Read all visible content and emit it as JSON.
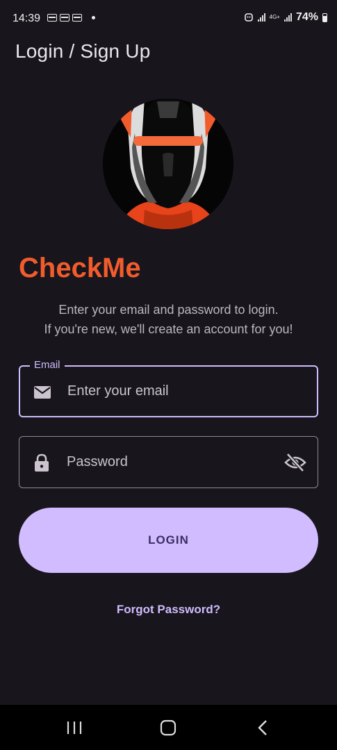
{
  "status_bar": {
    "time": "14:39",
    "network": "4G+",
    "battery": "74%"
  },
  "app_bar": {
    "title": "Login / Sign Up"
  },
  "brand": {
    "name": "CheckMe",
    "color": "#f25c2c"
  },
  "subtitle": {
    "line1": "Enter your email and password to login.",
    "line2": "If you're new, we'll create an account for you!"
  },
  "email_field": {
    "label": "Email",
    "placeholder": "Enter your email",
    "value": "",
    "icon": "mail-icon"
  },
  "password_field": {
    "placeholder": "Password",
    "value": "",
    "icon": "lock-icon",
    "toggle_icon": "eye-off-icon"
  },
  "login_button": {
    "label": "LOGIN"
  },
  "forgot_password": {
    "label": "Forgot Password?"
  },
  "colors": {
    "background": "#18151c",
    "accent": "#d0bcff",
    "brand": "#f25c2c"
  },
  "nav_bar": {
    "items": [
      "recent-apps-icon",
      "home-icon",
      "back-icon"
    ]
  }
}
